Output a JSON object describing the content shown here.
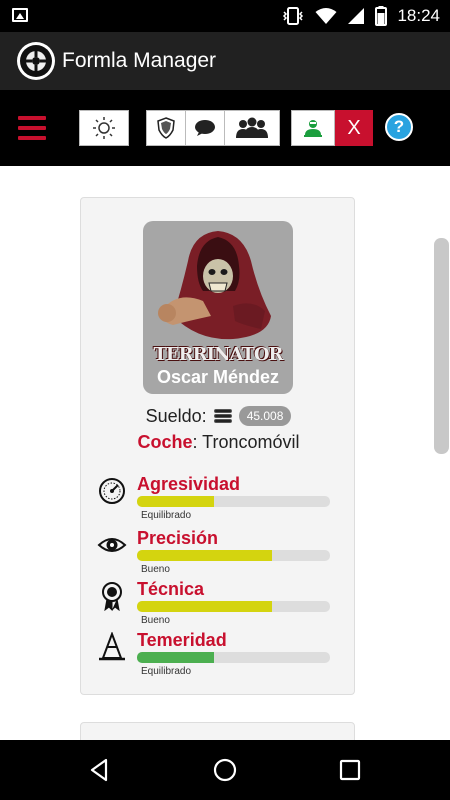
{
  "status_bar": {
    "time": "18:24"
  },
  "app": {
    "title": "Formla Manager"
  },
  "toolbar": {
    "close_label": "X",
    "help_label": "?"
  },
  "driver": {
    "name": "Oscar Méndez",
    "portrait_logo": "TERRINATOR",
    "salary_label": "Sueldo:",
    "salary_value": "45.008",
    "car_label": "Coche",
    "car_value": ": Troncomóvil"
  },
  "stats": [
    {
      "name": "Agresividad",
      "level": "Equilibrado",
      "value": 0.4,
      "color": "#d4d40f",
      "icon": "tachometer-icon"
    },
    {
      "name": "Precisión",
      "level": "Bueno",
      "value": 0.7,
      "color": "#d4d40f",
      "icon": "eye-icon"
    },
    {
      "name": "Técnica",
      "level": "Bueno",
      "value": 0.7,
      "color": "#d4d40f",
      "icon": "medal-icon"
    },
    {
      "name": "Temeridad",
      "level": "Equilibrado",
      "value": 0.4,
      "color": "#4caf50",
      "icon": "cone-icon"
    }
  ],
  "colors": {
    "accent": "#c8102e",
    "help": "#29a3e0",
    "portrait_bg": "#a6a6a6"
  }
}
